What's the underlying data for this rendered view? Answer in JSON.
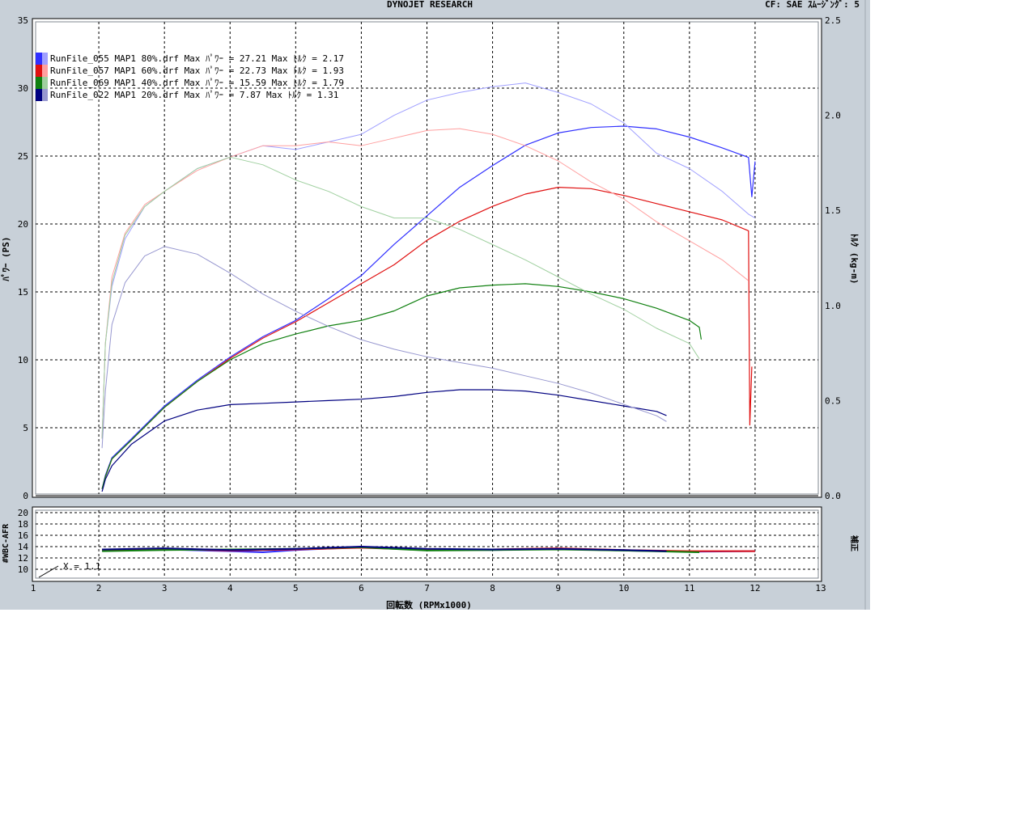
{
  "header": {
    "title": "DYNOJET  RESEARCH",
    "right": "CF: SAE  ｽﾑｰｼﾞﾝｸﾞ: 5"
  },
  "colors": {
    "window_bg": "#c8d0d8",
    "plot_bg": "#ffffff",
    "grid": "#000000",
    "torque_axis_color": "#000000"
  },
  "chart_data": [
    {
      "type": "line",
      "xlabel": "回転数 (RPMx1000)",
      "ylabel": "ﾊﾟﾜｰ (PS)",
      "y2label": "ﾄﾙｸ (kg-m)",
      "xlim": [
        1,
        13
      ],
      "ylim": [
        0,
        35
      ],
      "y2lim": [
        0.0,
        2.5
      ],
      "x_ticks": [
        1,
        2,
        3,
        4,
        5,
        6,
        7,
        8,
        9,
        10,
        11,
        12,
        13
      ],
      "y_ticks": [
        0,
        5,
        10,
        15,
        20,
        25,
        30,
        35
      ],
      "y2_ticks": [
        "0.0",
        "0.5",
        "1.0",
        "1.5",
        "2.0",
        "2.5"
      ],
      "grid": true,
      "legend_position": "top-left",
      "legend": [
        {
          "text": "RunFile_055 MAP1 80%.drf Max ﾊﾟﾜｰ = 27.21  Max ﾄﾙｸ = 2.17",
          "color": "#3030ff",
          "light": "#a0a0ff"
        },
        {
          "text": "RunFile_057 MAP1 60%.drf Max ﾊﾟﾜｰ = 22.73  Max ﾄﾙｸ = 1.93",
          "color": "#e01010",
          "light": "#ffa0a0"
        },
        {
          "text": "RunFile_069 MAP1 40%.drf Max ﾊﾟﾜｰ = 15.59  Max ﾄﾙｸ = 1.79",
          "color": "#108010",
          "light": "#a0d0a0"
        },
        {
          "text": "RunFile_022 MAP1 20%.drf Max ﾊﾟﾜｰ = 7.87   Max ﾄﾙｸ = 1.31",
          "color": "#000080",
          "light": "#9898d0"
        }
      ],
      "series": [
        {
          "kind": "power",
          "axis": "left",
          "color": "#3030ff",
          "width": 1.2,
          "x": [
            2.05,
            2.1,
            2.2,
            2.5,
            3,
            3.5,
            4,
            4.5,
            5,
            5.5,
            6,
            6.5,
            7,
            7.5,
            8,
            8.5,
            9,
            9.5,
            10,
            10.5,
            11,
            11.5,
            11.9,
            11.95,
            12.0
          ],
          "y": [
            0.5,
            1.5,
            2.8,
            4.2,
            6.6,
            8.5,
            10.2,
            11.7,
            12.9,
            14.5,
            16.2,
            18.5,
            20.6,
            22.7,
            24.3,
            25.8,
            26.7,
            27.1,
            27.2,
            27.0,
            26.4,
            25.6,
            24.9,
            22.0,
            24.6
          ]
        },
        {
          "kind": "torque",
          "axis": "right",
          "color": "#a0a0ff",
          "width": 1,
          "x": [
            2.05,
            2.1,
            2.2,
            2.4,
            2.7,
            3,
            3.5,
            4,
            4.5,
            5,
            5.5,
            6,
            6.5,
            7,
            7.5,
            8,
            8.5,
            9,
            9.5,
            10,
            10.5,
            11,
            11.5,
            11.9,
            12.0
          ],
          "y": [
            0.3,
            0.8,
            1.1,
            1.35,
            1.52,
            1.6,
            1.72,
            1.78,
            1.84,
            1.82,
            1.86,
            1.9,
            2.0,
            2.08,
            2.12,
            2.15,
            2.17,
            2.12,
            2.06,
            1.96,
            1.8,
            1.72,
            1.6,
            1.48,
            1.46
          ]
        },
        {
          "kind": "power",
          "axis": "left",
          "color": "#e01010",
          "width": 1.2,
          "x": [
            2.05,
            2.1,
            2.2,
            2.5,
            3,
            3.5,
            4,
            4.5,
            5,
            5.5,
            6,
            6.5,
            7,
            7.5,
            8,
            8.5,
            9,
            9.5,
            10,
            10.5,
            11,
            11.5,
            11.9,
            11.92,
            11.95
          ],
          "y": [
            0.5,
            1.4,
            2.7,
            4.1,
            6.5,
            8.4,
            10.1,
            11.6,
            12.8,
            14.2,
            15.6,
            17.0,
            18.8,
            20.2,
            21.3,
            22.2,
            22.7,
            22.6,
            22.1,
            21.5,
            20.9,
            20.3,
            19.5,
            5.2,
            9.5
          ]
        },
        {
          "kind": "torque",
          "axis": "right",
          "color": "#ffa0a0",
          "width": 1,
          "x": [
            2.05,
            2.1,
            2.2,
            2.4,
            2.7,
            3,
            3.5,
            4,
            4.5,
            5,
            5.5,
            6,
            6.5,
            7,
            7.5,
            8,
            8.5,
            9,
            9.5,
            10,
            10.5,
            11,
            11.5,
            11.9
          ],
          "y": [
            0.3,
            0.8,
            1.15,
            1.38,
            1.53,
            1.6,
            1.71,
            1.78,
            1.84,
            1.84,
            1.86,
            1.84,
            1.88,
            1.92,
            1.93,
            1.9,
            1.84,
            1.76,
            1.65,
            1.56,
            1.44,
            1.34,
            1.24,
            1.13
          ]
        },
        {
          "kind": "power",
          "axis": "left",
          "color": "#108010",
          "width": 1.2,
          "x": [
            2.05,
            2.1,
            2.2,
            2.5,
            3,
            3.5,
            4,
            4.5,
            5,
            5.5,
            6,
            6.5,
            7,
            7.5,
            8,
            8.5,
            9,
            9.5,
            10,
            10.5,
            11,
            11.15,
            11.18
          ],
          "y": [
            0.5,
            1.4,
            2.7,
            4.1,
            6.5,
            8.4,
            10.0,
            11.2,
            11.9,
            12.5,
            12.9,
            13.6,
            14.7,
            15.3,
            15.5,
            15.6,
            15.4,
            15.0,
            14.5,
            13.8,
            12.9,
            12.4,
            11.5
          ]
        },
        {
          "kind": "torque",
          "axis": "right",
          "color": "#a0d0a0",
          "width": 1,
          "x": [
            2.05,
            2.1,
            2.2,
            2.4,
            2.7,
            3,
            3.5,
            4,
            4.5,
            5,
            5.5,
            6,
            6.5,
            7,
            7.5,
            8,
            8.5,
            9,
            9.5,
            10,
            10.5,
            11,
            11.15
          ],
          "y": [
            0.3,
            0.8,
            1.12,
            1.37,
            1.52,
            1.6,
            1.72,
            1.78,
            1.74,
            1.66,
            1.6,
            1.52,
            1.46,
            1.46,
            1.4,
            1.32,
            1.24,
            1.15,
            1.06,
            0.98,
            0.88,
            0.8,
            0.72
          ]
        },
        {
          "kind": "power",
          "axis": "left",
          "color": "#000080",
          "width": 1.2,
          "x": [
            2.05,
            2.1,
            2.2,
            2.5,
            3,
            3.5,
            4,
            4.5,
            5,
            5.5,
            6,
            6.5,
            7,
            7.5,
            8,
            8.5,
            9,
            9.5,
            10,
            10.5,
            10.65
          ],
          "y": [
            0.3,
            1.2,
            2.2,
            3.8,
            5.5,
            6.3,
            6.7,
            6.8,
            6.9,
            7.0,
            7.1,
            7.3,
            7.6,
            7.8,
            7.8,
            7.7,
            7.4,
            7.0,
            6.6,
            6.2,
            5.9
          ]
        },
        {
          "kind": "torque",
          "axis": "right",
          "color": "#9898d0",
          "width": 1,
          "x": [
            2.05,
            2.1,
            2.2,
            2.4,
            2.7,
            3,
            3.5,
            4,
            4.5,
            5,
            5.5,
            6,
            6.5,
            7,
            7.5,
            8,
            8.5,
            9,
            9.5,
            10,
            10.5,
            10.65
          ],
          "y": [
            0.25,
            0.55,
            0.9,
            1.12,
            1.26,
            1.31,
            1.27,
            1.17,
            1.06,
            0.97,
            0.89,
            0.82,
            0.77,
            0.73,
            0.7,
            0.67,
            0.63,
            0.59,
            0.54,
            0.48,
            0.42,
            0.39
          ]
        }
      ]
    },
    {
      "type": "line",
      "ylabel": "#WBC-AFR",
      "y2label": "補正",
      "xlim": [
        1,
        13
      ],
      "ylim": [
        9,
        21
      ],
      "y_ticks": [
        10,
        12,
        14,
        16,
        18,
        20
      ],
      "annotation": "X = 1.1",
      "series": [
        {
          "color": "#3030ff",
          "x": [
            2.05,
            3,
            4,
            4.5,
            5,
            6,
            7,
            8,
            9,
            10,
            11,
            12
          ],
          "y": [
            13.3,
            13.5,
            13.2,
            13.0,
            13.4,
            13.9,
            13.5,
            13.4,
            13.6,
            13.3,
            13.1,
            13.2
          ]
        },
        {
          "color": "#e01010",
          "x": [
            2.05,
            3,
            4,
            5,
            6,
            7,
            8,
            9,
            10,
            11,
            12
          ],
          "y": [
            13.4,
            13.6,
            13.3,
            13.5,
            13.8,
            13.4,
            13.5,
            13.7,
            13.4,
            13.2,
            13.2
          ]
        },
        {
          "color": "#108010",
          "x": [
            2.05,
            3,
            4,
            5,
            6,
            7,
            8,
            9,
            10,
            11.15
          ],
          "y": [
            13.2,
            13.4,
            13.5,
            13.6,
            13.9,
            13.3,
            13.4,
            13.5,
            13.3,
            13.0
          ]
        },
        {
          "color": "#000080",
          "x": [
            2.05,
            3,
            4,
            5,
            6,
            7,
            8,
            9,
            10,
            10.65
          ],
          "y": [
            13.5,
            13.7,
            13.4,
            13.6,
            14.0,
            13.6,
            13.5,
            13.6,
            13.4,
            13.2
          ]
        }
      ]
    }
  ]
}
